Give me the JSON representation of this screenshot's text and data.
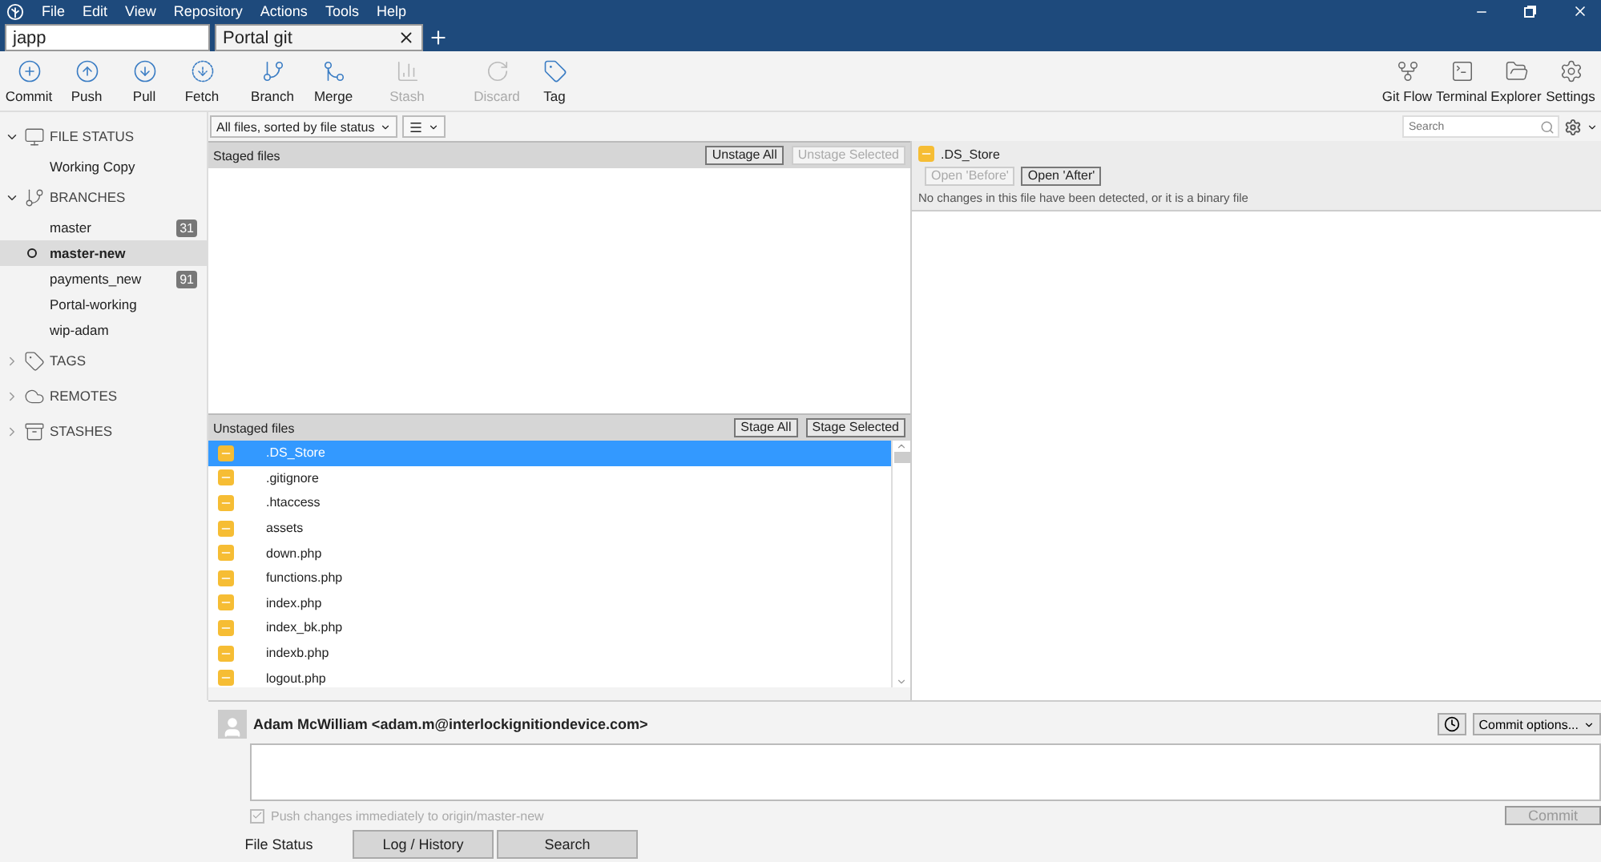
{
  "menu": [
    "File",
    "Edit",
    "View",
    "Repository",
    "Actions",
    "Tools",
    "Help"
  ],
  "tabs": [
    {
      "label": "japp",
      "selected": false
    },
    {
      "label": "Portal git",
      "selected": true
    }
  ],
  "toolbar": [
    {
      "label": "Commit",
      "disabled": false
    },
    {
      "label": "Push",
      "disabled": false
    },
    {
      "label": "Pull",
      "disabled": false
    },
    {
      "label": "Fetch",
      "disabled": false
    },
    {
      "label": "Branch",
      "disabled": false
    },
    {
      "label": "Merge",
      "disabled": false
    },
    {
      "label": "Stash",
      "disabled": true
    },
    {
      "label": "Discard",
      "disabled": true
    },
    {
      "label": "Tag",
      "disabled": false
    }
  ],
  "toolbar_right": [
    {
      "label": "Git Flow"
    },
    {
      "label": "Terminal"
    },
    {
      "label": "Explorer"
    },
    {
      "label": "Settings"
    }
  ],
  "filter": "All files, sorted by file status",
  "search": {
    "placeholder": "Search"
  },
  "sidebar": [
    {
      "title": "FILE STATUS",
      "expanded": true,
      "items": [
        {
          "label": "Working Copy",
          "selected": false,
          "current": false
        }
      ]
    },
    {
      "title": "BRANCHES",
      "expanded": true,
      "items": [
        {
          "label": "master",
          "badge": "31",
          "selected": false,
          "current": false
        },
        {
          "label": "master-new",
          "selected": true,
          "current": true
        },
        {
          "label": "payments_new",
          "badge": "91",
          "selected": false,
          "current": false
        },
        {
          "label": "Portal-working",
          "selected": false,
          "current": false
        },
        {
          "label": "wip-adam",
          "selected": false,
          "current": false
        }
      ]
    },
    {
      "title": "TAGS",
      "expanded": false
    },
    {
      "title": "REMOTES",
      "expanded": false
    },
    {
      "title": "STASHES",
      "expanded": false
    }
  ],
  "staged": {
    "title": "Staged files",
    "buttons": [
      {
        "label": "Unstage All",
        "disabled": false
      },
      {
        "label": "Unstage Selected",
        "disabled": true
      }
    ]
  },
  "unstaged": {
    "title": "Unstaged files",
    "buttons": [
      {
        "label": "Stage All",
        "disabled": false
      },
      {
        "label": "Stage Selected",
        "disabled": false
      }
    ],
    "files": [
      {
        "name": ".DS_Store",
        "selected": true
      },
      {
        "name": ".gitignore",
        "selected": false
      },
      {
        "name": ".htaccess",
        "selected": false
      },
      {
        "name": "assets",
        "selected": false
      },
      {
        "name": "down.php",
        "selected": false
      },
      {
        "name": "functions.php",
        "selected": false
      },
      {
        "name": "index.php",
        "selected": false
      },
      {
        "name": "index_bk.php",
        "selected": false
      },
      {
        "name": "indexb.php",
        "selected": false
      },
      {
        "name": "logout.php",
        "selected": false
      }
    ]
  },
  "diff": {
    "file": ".DS_Store",
    "buttons": [
      {
        "label": "Open 'Before'",
        "disabled": true
      },
      {
        "label": "Open 'After'",
        "disabled": false
      }
    ],
    "message": "No changes in this file have been detected, or it is a binary file"
  },
  "commit": {
    "author": "Adam McWilliam <adam.m@interlockignitiondevice.com>",
    "options": "Commit options...",
    "push": {
      "label": "Push changes immediately to origin/master-new",
      "checked": true,
      "disabled": true
    },
    "button": {
      "label": "Commit",
      "disabled": true
    }
  },
  "bottom_tabs": [
    {
      "label": "File Status",
      "selected": true
    },
    {
      "label": "Log / History",
      "selected": false
    },
    {
      "label": "Search",
      "selected": false
    }
  ]
}
